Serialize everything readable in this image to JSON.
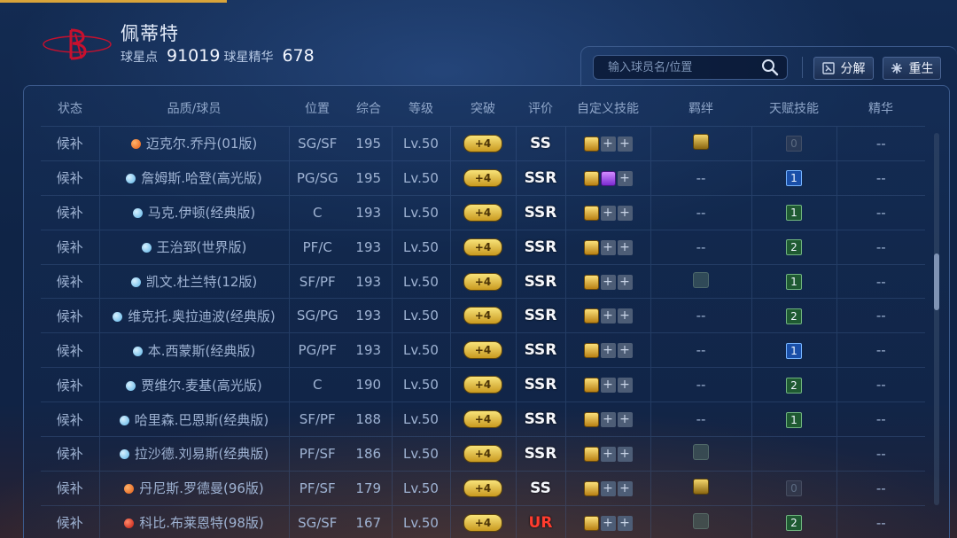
{
  "header": {
    "team_logo": "houston-rockets-logo",
    "player_name": "佩蒂特",
    "star_points_label": "球星点",
    "star_points_value": "91019",
    "star_essence_label": "球星精华",
    "star_essence_value": "678",
    "search_placeholder": "输入球员名/位置",
    "decompose_label": "分解",
    "rebirth_label": "重生"
  },
  "table": {
    "columns": [
      "状态",
      "品质/球员",
      "位置",
      "综合",
      "等级",
      "突破",
      "评价",
      "自定义技能",
      "羁绊",
      "天赋技能",
      "精华"
    ],
    "rows": [
      {
        "status": "候补",
        "quality": "orange",
        "name": "迈克尔.乔丹(01版)",
        "position": "SG/SF",
        "overall": "195",
        "level": "Lv.50",
        "breakthrough": "+4",
        "grade": "SS",
        "skills": [
          "gold",
          "plus",
          "plus"
        ],
        "bond": "gold",
        "bond_text": "",
        "talent": "0",
        "talent_color": "dim",
        "essence": "--"
      },
      {
        "status": "候补",
        "quality": "blue",
        "name": "詹姆斯.哈登(高光版)",
        "position": "PG/SG",
        "overall": "195",
        "level": "Lv.50",
        "breakthrough": "+4",
        "grade": "SSR",
        "skills": [
          "gold",
          "purple",
          "plus"
        ],
        "bond": "none",
        "bond_text": "--",
        "talent": "1",
        "talent_color": "blue",
        "essence": "--"
      },
      {
        "status": "候补",
        "quality": "blue",
        "name": "马克.伊顿(经典版)",
        "position": "C",
        "overall": "193",
        "level": "Lv.50",
        "breakthrough": "+4",
        "grade": "SSR",
        "skills": [
          "gold",
          "plus",
          "plus"
        ],
        "bond": "none",
        "bond_text": "--",
        "talent": "1",
        "talent_color": "green",
        "essence": "--"
      },
      {
        "status": "候补",
        "quality": "blue",
        "name": "王治郅(世界版)",
        "position": "PF/C",
        "overall": "193",
        "level": "Lv.50",
        "breakthrough": "+4",
        "grade": "SSR",
        "skills": [
          "gold",
          "plus",
          "plus"
        ],
        "bond": "none",
        "bond_text": "--",
        "talent": "2",
        "talent_color": "green",
        "essence": "--"
      },
      {
        "status": "候补",
        "quality": "blue",
        "name": "凯文.杜兰特(12版)",
        "position": "SF/PF",
        "overall": "193",
        "level": "Lv.50",
        "breakthrough": "+4",
        "grade": "SSR",
        "skills": [
          "gold",
          "plus",
          "plus"
        ],
        "bond": "dim",
        "bond_text": "",
        "talent": "1",
        "talent_color": "green",
        "essence": "--"
      },
      {
        "status": "候补",
        "quality": "blue",
        "name": "维克托.奥拉迪波(经典版)",
        "position": "SG/PG",
        "overall": "193",
        "level": "Lv.50",
        "breakthrough": "+4",
        "grade": "SSR",
        "skills": [
          "gold",
          "plus",
          "plus"
        ],
        "bond": "none",
        "bond_text": "--",
        "talent": "2",
        "talent_color": "green",
        "essence": "--"
      },
      {
        "status": "候补",
        "quality": "blue",
        "name": "本.西蒙斯(经典版)",
        "position": "PG/PF",
        "overall": "193",
        "level": "Lv.50",
        "breakthrough": "+4",
        "grade": "SSR",
        "skills": [
          "gold",
          "plus",
          "plus"
        ],
        "bond": "none",
        "bond_text": "--",
        "talent": "1",
        "talent_color": "blue",
        "essence": "--"
      },
      {
        "status": "候补",
        "quality": "blue",
        "name": "贾维尔.麦基(高光版)",
        "position": "C",
        "overall": "190",
        "level": "Lv.50",
        "breakthrough": "+4",
        "grade": "SSR",
        "skills": [
          "gold",
          "plus",
          "plus"
        ],
        "bond": "none",
        "bond_text": "--",
        "talent": "2",
        "talent_color": "green",
        "essence": "--"
      },
      {
        "status": "候补",
        "quality": "blue",
        "name": "哈里森.巴恩斯(经典版)",
        "position": "SF/PF",
        "overall": "188",
        "level": "Lv.50",
        "breakthrough": "+4",
        "grade": "SSR",
        "skills": [
          "gold",
          "plus",
          "plus"
        ],
        "bond": "none",
        "bond_text": "--",
        "talent": "1",
        "talent_color": "green",
        "essence": "--"
      },
      {
        "status": "候补",
        "quality": "blue",
        "name": "拉沙德.刘易斯(经典版)",
        "position": "PF/SF",
        "overall": "186",
        "level": "Lv.50",
        "breakthrough": "+4",
        "grade": "SSR",
        "skills": [
          "gold",
          "plus",
          "plus"
        ],
        "bond": "dim",
        "bond_text": "",
        "talent": "",
        "talent_color": "none",
        "essence": "--"
      },
      {
        "status": "候补",
        "quality": "orange",
        "name": "丹尼斯.罗德曼(96版)",
        "position": "PF/SF",
        "overall": "179",
        "level": "Lv.50",
        "breakthrough": "+4",
        "grade": "SS",
        "skills": [
          "gold",
          "plus",
          "plus"
        ],
        "bond": "gold",
        "bond_text": "",
        "talent": "0",
        "talent_color": "dim",
        "essence": "--"
      },
      {
        "status": "候补",
        "quality": "red",
        "name": "科比.布莱恩特(98版)",
        "position": "SG/SF",
        "overall": "167",
        "level": "Lv.50",
        "breakthrough": "+4",
        "grade": "UR",
        "skills": [
          "gold",
          "plus",
          "plus"
        ],
        "bond": "dim",
        "bond_text": "",
        "talent": "2",
        "talent_color": "green",
        "essence": "--"
      }
    ]
  },
  "colors": {
    "accent_gold": "#d9a43a",
    "grade_ur": "#ff3c2e",
    "talent_blue": "#1a4fa8",
    "talent_green": "#1f5a32"
  }
}
